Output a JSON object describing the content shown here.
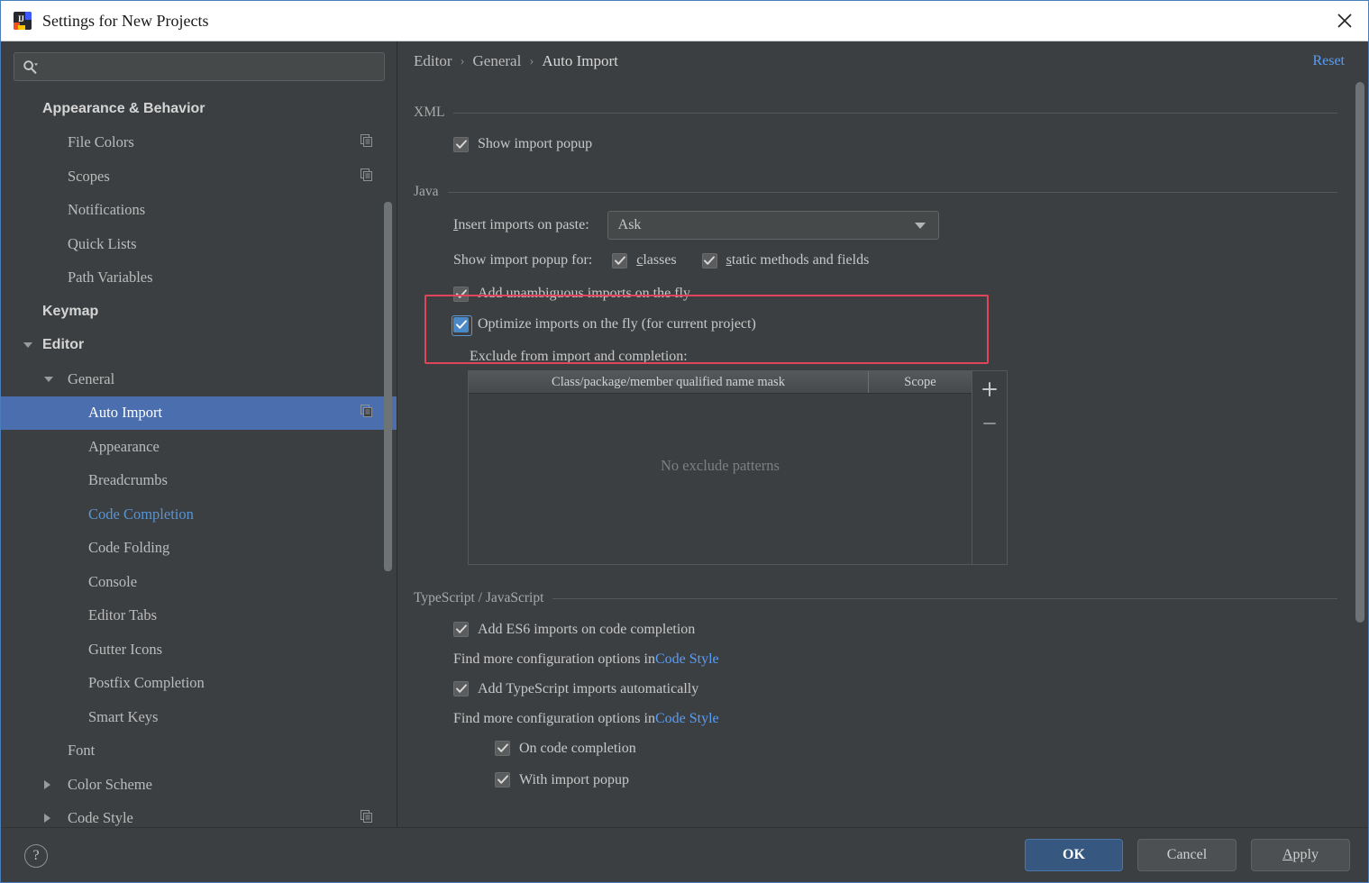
{
  "window": {
    "title": "Settings for New Projects",
    "app_icon": "intellij-idea-logo",
    "close_icon": "close-icon"
  },
  "sidebar": {
    "search": {
      "placeholder": "",
      "value": "",
      "icon": "search-icon"
    },
    "items": [
      {
        "label": "Appearance & Behavior",
        "level": 0,
        "twisty": "none",
        "selected": false,
        "modified": false,
        "copy_icon": false
      },
      {
        "label": "File Colors",
        "level": 1,
        "twisty": "none",
        "selected": false,
        "modified": false,
        "copy_icon": true
      },
      {
        "label": "Scopes",
        "level": 1,
        "twisty": "none",
        "selected": false,
        "modified": false,
        "copy_icon": true
      },
      {
        "label": "Notifications",
        "level": 1,
        "twisty": "none",
        "selected": false,
        "modified": false,
        "copy_icon": false
      },
      {
        "label": "Quick Lists",
        "level": 1,
        "twisty": "none",
        "selected": false,
        "modified": false,
        "copy_icon": false
      },
      {
        "label": "Path Variables",
        "level": 1,
        "twisty": "none",
        "selected": false,
        "modified": false,
        "copy_icon": false
      },
      {
        "label": "Keymap",
        "level": 0,
        "twisty": "none",
        "selected": false,
        "modified": false,
        "copy_icon": false
      },
      {
        "label": "Editor",
        "level": 0,
        "twisty": "down",
        "selected": false,
        "modified": false,
        "copy_icon": false
      },
      {
        "label": "General",
        "level": 1,
        "twisty": "down1",
        "selected": false,
        "modified": false,
        "copy_icon": false
      },
      {
        "label": "Auto Import",
        "level": 2,
        "twisty": "none",
        "selected": true,
        "modified": false,
        "copy_icon": true
      },
      {
        "label": "Appearance",
        "level": 2,
        "twisty": "none",
        "selected": false,
        "modified": false,
        "copy_icon": false
      },
      {
        "label": "Breadcrumbs",
        "level": 2,
        "twisty": "none",
        "selected": false,
        "modified": false,
        "copy_icon": false
      },
      {
        "label": "Code Completion",
        "level": 2,
        "twisty": "none",
        "selected": false,
        "modified": true,
        "copy_icon": false
      },
      {
        "label": "Code Folding",
        "level": 2,
        "twisty": "none",
        "selected": false,
        "modified": false,
        "copy_icon": false
      },
      {
        "label": "Console",
        "level": 2,
        "twisty": "none",
        "selected": false,
        "modified": false,
        "copy_icon": false
      },
      {
        "label": "Editor Tabs",
        "level": 2,
        "twisty": "none",
        "selected": false,
        "modified": false,
        "copy_icon": false
      },
      {
        "label": "Gutter Icons",
        "level": 2,
        "twisty": "none",
        "selected": false,
        "modified": false,
        "copy_icon": false
      },
      {
        "label": "Postfix Completion",
        "level": 2,
        "twisty": "none",
        "selected": false,
        "modified": false,
        "copy_icon": false
      },
      {
        "label": "Smart Keys",
        "level": 2,
        "twisty": "none",
        "selected": false,
        "modified": false,
        "copy_icon": false
      },
      {
        "label": "Font",
        "level": 1,
        "twisty": "none",
        "selected": false,
        "modified": false,
        "copy_icon": false
      },
      {
        "label": "Color Scheme",
        "level": 1,
        "twisty": "right",
        "selected": false,
        "modified": false,
        "copy_icon": false
      },
      {
        "label": "Code Style",
        "level": 1,
        "twisty": "right",
        "selected": false,
        "modified": false,
        "copy_icon": true
      }
    ]
  },
  "breadcrumb": {
    "items": [
      "Editor",
      "General",
      "Auto Import"
    ],
    "separator": "›",
    "reset_label": "Reset"
  },
  "sections": {
    "xml": {
      "title": "XML",
      "show_import_popup": {
        "label": "Show import popup",
        "checked": true,
        "style": "gray"
      }
    },
    "java": {
      "title": "Java",
      "insert_imports_label": "Insert imports on paste:",
      "insert_imports_mnemonic": "I",
      "insert_imports_value": "Ask",
      "show_popup_for_label": "Show import popup for:",
      "classes": {
        "label": "classes",
        "mnemonic": "c",
        "checked": true,
        "style": "gray"
      },
      "static_methods": {
        "label": "static methods and fields",
        "mnemonic": "s",
        "checked": true,
        "style": "gray"
      },
      "add_unambiguous": {
        "label": "Add unambiguous imports on the fly",
        "checked": true,
        "style": "gray"
      },
      "optimize_imports": {
        "label": "Optimize imports on the fly (for current project)",
        "checked": true,
        "style": "blue"
      },
      "exclude_label": "Exclude from import and completion:",
      "exclude_table": {
        "columns": [
          "Class/package/member qualified name mask",
          "Scope"
        ],
        "rows": [],
        "empty_text": "No exclude patterns",
        "add_icon": "plus-icon",
        "remove_icon": "minus-icon"
      }
    },
    "ts_js": {
      "title": "TypeScript / JavaScript",
      "es6_imports": {
        "label": "Add ES6 imports on code completion",
        "checked": true,
        "style": "gray"
      },
      "find_more_1": {
        "prefix": "Find more configuration options in ",
        "link": "Code Style"
      },
      "ts_imports": {
        "label": "Add TypeScript imports automatically",
        "checked": true,
        "style": "gray"
      },
      "find_more_2": {
        "prefix": "Find more configuration options in ",
        "link": "Code Style"
      },
      "on_code_completion": {
        "label": "On code completion",
        "checked": true,
        "style": "gray"
      },
      "with_import_popup": {
        "label": "With import popup",
        "checked": true,
        "style": "gray"
      }
    }
  },
  "footer": {
    "help_label": "?",
    "ok_label": "OK",
    "cancel_label": "Cancel",
    "apply_label": "Apply",
    "apply_mnemonic": "A"
  },
  "colors": {
    "background": "#3c3f41",
    "selection": "#4b6eaf",
    "link": "#589df6",
    "highlight_box": "#e0455a",
    "checkbox_focus": "#4a88c7",
    "ok_button": "#365880"
  }
}
